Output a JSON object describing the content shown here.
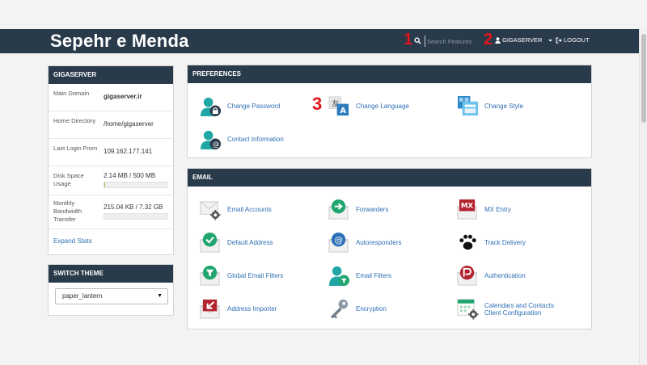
{
  "header": {
    "brand": "Sepehr e Menda",
    "search": {
      "placeholder": "Search Features"
    },
    "user": "GIGASERVER",
    "logout": "LOGOUT",
    "marks": [
      "1",
      "2",
      "3"
    ]
  },
  "stats": {
    "title": "GIGASERVER",
    "rows": [
      {
        "label": "Main Domain",
        "value": "gigaserver.ir"
      },
      {
        "label": "Home Directory",
        "value": "/home/gigaserver"
      },
      {
        "label": "Last Login From",
        "value": "109.162.177.141"
      },
      {
        "label": "Disk Space Usage",
        "value": "2.14 MB / 500 MB",
        "fraction": 0.004
      },
      {
        "label": "Monthly Bandwidth Transfer",
        "value": "215.04 KB / 7.32 GB",
        "fraction": 0.0
      }
    ],
    "expand": "Expand Stats"
  },
  "theme": {
    "title": "SWITCH THEME",
    "selected": "paper_lantern"
  },
  "preferences": {
    "title": "PREFERENCES",
    "items": [
      {
        "label": "Change Password",
        "icon": "user-lock-icon"
      },
      {
        "label": "Change Language",
        "icon": "language-icon"
      },
      {
        "label": "Change Style",
        "icon": "style-icon"
      },
      {
        "label": "Contact Information",
        "icon": "user-contact-icon"
      }
    ]
  },
  "email": {
    "title": "EMAIL",
    "items": [
      {
        "label": "Email Accounts",
        "icon": "envelope-gear-icon"
      },
      {
        "label": "Forwarders",
        "icon": "forward-arrow-icon"
      },
      {
        "label": "MX Entry",
        "icon": "mx-icon",
        "badge": "MX"
      },
      {
        "label": "Default Address",
        "icon": "checkmark-envelope-icon"
      },
      {
        "label": "Autoresponders",
        "icon": "at-sign-icon"
      },
      {
        "label": "Track Delivery",
        "icon": "paw-print-icon"
      },
      {
        "label": "Global Email Filters",
        "icon": "global-filter-icon"
      },
      {
        "label": "Email Filters",
        "icon": "user-filter-icon"
      },
      {
        "label": "Authentication",
        "icon": "authentication-icon"
      },
      {
        "label": "Address Importer",
        "icon": "import-icon"
      },
      {
        "label": "Encryption",
        "icon": "key-icon"
      },
      {
        "label": "Calendars and Contacts",
        "label2": "Client Configuration",
        "icon": "calendar-gear-icon"
      }
    ]
  },
  "colors": {
    "header": "#293a4a",
    "link": "#2f6fb4",
    "mark": "#e3141b",
    "green": "#20a66e",
    "red": "#b3232f"
  }
}
